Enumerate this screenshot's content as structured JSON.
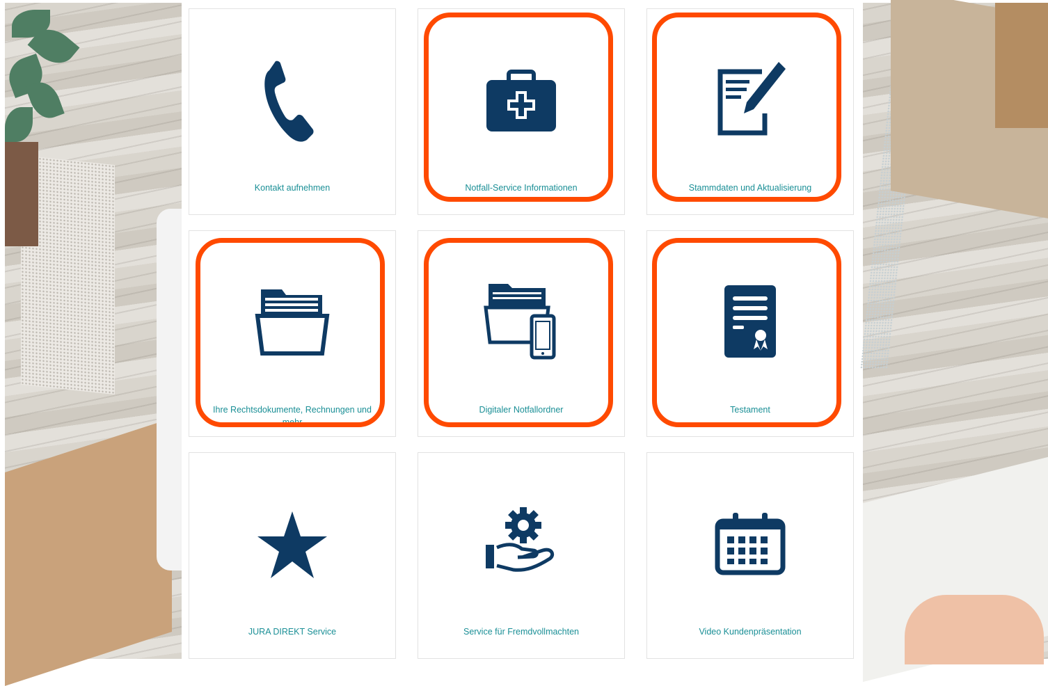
{
  "colors": {
    "icon_navy": "#0e3a63",
    "label_teal": "#1a8f96",
    "highlight_orange": "#ff4a00",
    "tile_border": "#e2e2e2"
  },
  "tiles": [
    {
      "label": "Kontakt aufnehmen",
      "icon": "phone-icon",
      "highlighted": false
    },
    {
      "label": "Notfall-Service Informationen",
      "icon": "first-aid-kit-icon",
      "highlighted": true
    },
    {
      "label": "Stammdaten und Aktualisierung",
      "icon": "edit-document-icon",
      "highlighted": true
    },
    {
      "label": "Ihre Rechtsdokumente, Rechnungen und mehr",
      "icon": "open-folder-icon",
      "highlighted": true
    },
    {
      "label": "Digitaler Notfallordner",
      "icon": "folder-smartphone-icon",
      "highlighted": true
    },
    {
      "label": "Testament",
      "icon": "certificate-document-icon",
      "highlighted": true
    },
    {
      "label": "JURA DIREKT Service",
      "icon": "star-icon",
      "highlighted": false
    },
    {
      "label": "Service für Fremdvollmachten",
      "icon": "hand-gear-icon",
      "highlighted": false
    },
    {
      "label": "Video Kundenpräsentation",
      "icon": "calendar-icon",
      "highlighted": false
    }
  ]
}
